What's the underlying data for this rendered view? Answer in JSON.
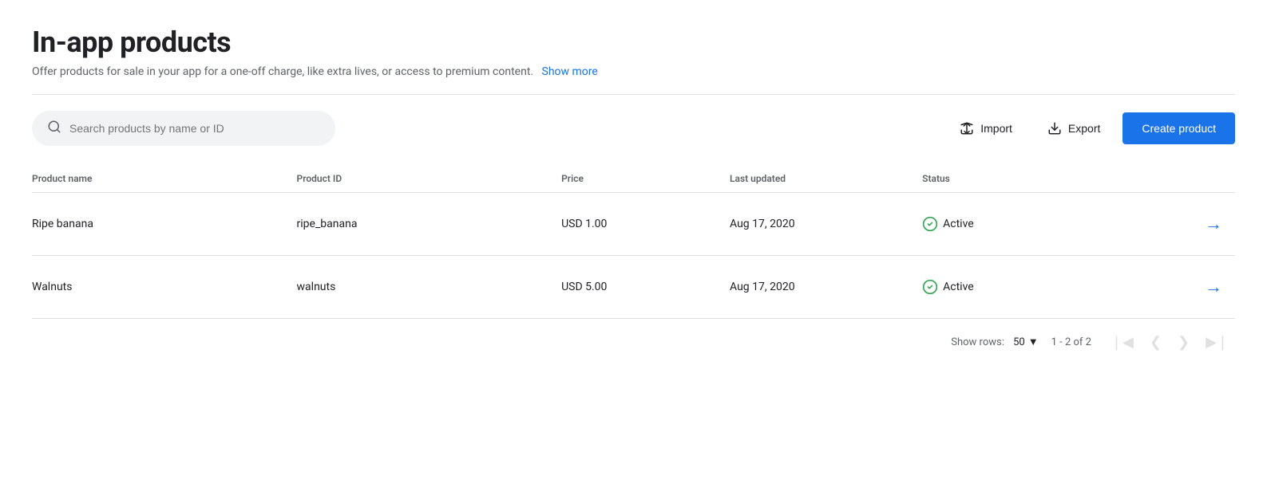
{
  "page": {
    "title": "In-app products",
    "subtitle": "Offer products for sale in your app for a one-off charge, like extra lives, or access to premium content.",
    "show_more_label": "Show more"
  },
  "toolbar": {
    "search_placeholder": "Search products by name or ID",
    "import_label": "Import",
    "export_label": "Export",
    "create_label": "Create product"
  },
  "table": {
    "columns": [
      {
        "key": "name",
        "label": "Product name"
      },
      {
        "key": "id",
        "label": "Product ID"
      },
      {
        "key": "price",
        "label": "Price"
      },
      {
        "key": "updated",
        "label": "Last updated"
      },
      {
        "key": "status",
        "label": "Status"
      }
    ],
    "rows": [
      {
        "name": "Ripe banana",
        "id": "ripe_banana",
        "price": "USD 1.00",
        "updated": "Aug 17, 2020",
        "status": "Active"
      },
      {
        "name": "Walnuts",
        "id": "walnuts",
        "price": "USD 5.00",
        "updated": "Aug 17, 2020",
        "status": "Active"
      }
    ]
  },
  "pagination": {
    "show_rows_label": "Show rows:",
    "rows_per_page": "50",
    "page_info": "1 - 2 of 2"
  },
  "colors": {
    "accent": "#1a73e8",
    "status_active": "#34a853"
  }
}
